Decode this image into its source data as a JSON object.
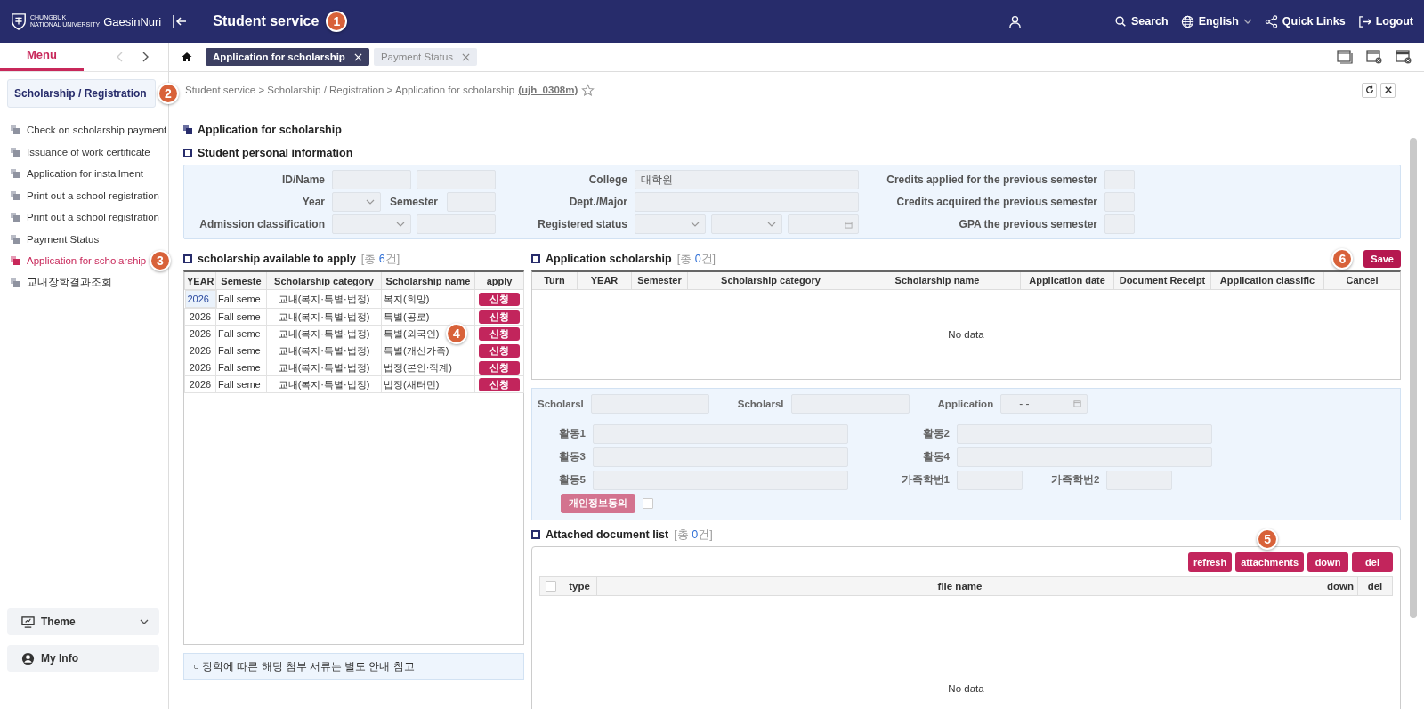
{
  "header": {
    "university": [
      "CHUNGBUK",
      "NATIONAL UNIVERSITY"
    ],
    "brand": "GaesinNuri",
    "title": "Student service",
    "callout": "1",
    "actions": [
      {
        "kind": "search",
        "label": "Search"
      },
      {
        "kind": "language",
        "label": "English"
      },
      {
        "kind": "share",
        "label": "Quick Links"
      },
      {
        "kind": "logout",
        "label": "Logout"
      }
    ]
  },
  "sidebar": {
    "tab": "Menu",
    "section": "Scholarship / Registration",
    "section_callout": "2",
    "items": [
      {
        "label": "Check on scholarship payment",
        "selected": false
      },
      {
        "label": "Issuance of work certificate",
        "selected": false
      },
      {
        "label": "Application for installment",
        "selected": false
      },
      {
        "label": "Print out a school registration",
        "selected": false
      },
      {
        "label": "Print out a school registration",
        "selected": false
      },
      {
        "label": "Payment Status",
        "selected": false
      },
      {
        "label": "Application for scholarship",
        "selected": true,
        "callout": "3"
      },
      {
        "label": "교내장학결과조회",
        "selected": false
      }
    ],
    "footer": [
      {
        "kind": "theme",
        "label": "Theme"
      },
      {
        "kind": "user",
        "label": "My Info"
      }
    ]
  },
  "tabs": [
    {
      "label": "Application for scholarship",
      "selected": true
    },
    {
      "label": "Payment Status",
      "selected": false
    }
  ],
  "breadcrumb": {
    "path": "Student service > Scholarship / Registration > Application for scholarship",
    "code": "(ujh_0308m)"
  },
  "page_title": "Application for scholarship",
  "personal_info": {
    "title": "Student personal information",
    "fields": [
      {
        "label": "ID/Name",
        "controls": [
          {
            "kind": "input"
          },
          {
            "kind": "input"
          }
        ]
      },
      {
        "label": "College",
        "controls": [
          {
            "kind": "input",
            "value": "대학원"
          }
        ]
      },
      {
        "label": "Credits applied for the previous semester",
        "controls": [
          {
            "kind": "input"
          }
        ]
      },
      {
        "label": "Year",
        "controls": [
          {
            "kind": "select"
          },
          {
            "kind": "label",
            "text": "Semester"
          },
          {
            "kind": "input"
          }
        ]
      },
      {
        "label": "Dept./Major",
        "controls": [
          {
            "kind": "input"
          }
        ]
      },
      {
        "label": "Credits acquired the previous semester",
        "controls": [
          {
            "kind": "input"
          }
        ]
      },
      {
        "label": "Admission classification",
        "controls": [
          {
            "kind": "select"
          },
          {
            "kind": "input"
          }
        ]
      },
      {
        "label": "Registered status",
        "controls": [
          {
            "kind": "select"
          },
          {
            "kind": "select"
          },
          {
            "kind": "date"
          }
        ]
      },
      {
        "label": "GPA the previous semester",
        "controls": [
          {
            "kind": "input"
          }
        ]
      }
    ]
  },
  "available": {
    "title": "scholarship available to apply",
    "count_open": "[총",
    "count": "6",
    "count_close": "건]",
    "callout": "4",
    "columns": [
      "YEAR",
      "Semeste",
      "Scholarship category",
      "Scholarship name",
      "apply"
    ],
    "rows": [
      {
        "year": "2026",
        "semester": "Fall seme",
        "category": "교내(복지·특별·법정)",
        "name": "복지(희망)",
        "action": "신청",
        "selected": true
      },
      {
        "year": "2026",
        "semester": "Fall seme",
        "category": "교내(복지·특별·법정)",
        "name": "특별(공로)",
        "action": "신청",
        "selected": false
      },
      {
        "year": "2026",
        "semester": "Fall seme",
        "category": "교내(복지·특별·법정)",
        "name": "특별(외국인)",
        "action": "신청",
        "selected": false
      },
      {
        "year": "2026",
        "semester": "Fall seme",
        "category": "교내(복지·특별·법정)",
        "name": "특별(개신가족)",
        "action": "신청",
        "selected": false
      },
      {
        "year": "2026",
        "semester": "Fall seme",
        "category": "교내(복지·특별·법정)",
        "name": "법정(본인·직계)",
        "action": "신청",
        "selected": false
      },
      {
        "year": "2026",
        "semester": "Fall seme",
        "category": "교내(복지·특별·법정)",
        "name": "법정(새터민)",
        "action": "신청",
        "selected": false
      }
    ],
    "note": "○ 장학에 따른 해당 첨부 서류는 별도 안내 참고"
  },
  "application": {
    "title": "Application scholarship",
    "count_open": "[총",
    "count": "0",
    "count_close": "건]",
    "save": "Save",
    "save_callout": "6",
    "columns": [
      "Turn",
      "YEAR",
      "Semester",
      "Scholarship category",
      "Scholarship name",
      "Application date",
      "Document Receipt",
      "Application classific",
      "Cancel"
    ],
    "empty": "No data"
  },
  "form": {
    "rows": [
      [
        {
          "label": "Scholarsl",
          "kind": "input"
        },
        {
          "label": "Scholarsl",
          "kind": "input"
        },
        {
          "label": "Application",
          "kind": "date",
          "value": "-  -"
        }
      ],
      [
        {
          "label": "활동1",
          "kind": "wide"
        },
        {
          "label": "활동2",
          "kind": "wide"
        }
      ],
      [
        {
          "label": "활동3",
          "kind": "wide"
        },
        {
          "label": "활동4",
          "kind": "wide"
        }
      ],
      [
        {
          "label": "활동5",
          "kind": "wide"
        },
        {
          "label": "가족학번1",
          "kind": "short"
        },
        {
          "label": "가족학번2",
          "kind": "short"
        }
      ]
    ],
    "consent": {
      "label": "개인정보동의",
      "disabled": true,
      "checked": false
    }
  },
  "attachments": {
    "title": "Attached document list",
    "count_open": "[총",
    "count": "0",
    "count_close": "건]",
    "buttons": [
      {
        "label": "refresh"
      },
      {
        "label": "attachments",
        "callout": "5"
      },
      {
        "label": "down"
      },
      {
        "label": "del"
      }
    ],
    "all_checked": false,
    "columns": [
      "type",
      "file name",
      "down",
      "del"
    ],
    "empty": "No data"
  }
}
